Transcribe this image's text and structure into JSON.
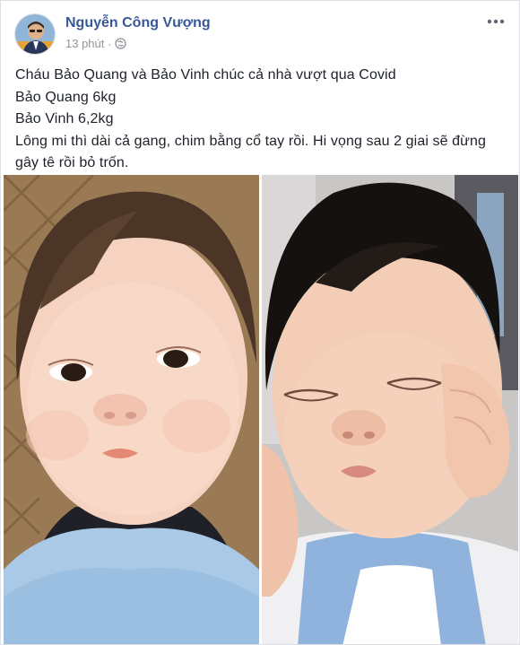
{
  "post": {
    "author": "Nguyễn Công Vượng",
    "time": "13 phút",
    "separator": "·",
    "privacy_icon": "globe-icon",
    "more_icon": "more-dots-icon",
    "text_lines": [
      "Cháu Bảo Quang và Bảo Vinh chúc cả nhà vượt qua Covid",
      "Bảo Quang 6kg",
      "Bảo Vinh 6,2kg",
      "Lông mi thì dài cả gang, chim bằng cổ tay rồi. Hi vọng sau 2 giai sẽ đừng",
      "gây tê rồi bỏ trốn."
    ],
    "photos": [
      {
        "name": "baby-photo-left",
        "subject": "baby with eyes open"
      },
      {
        "name": "baby-photo-right",
        "subject": "baby sleeping"
      }
    ]
  },
  "colors": {
    "author": "#385898",
    "text": "#1d2129",
    "meta": "#8f949b",
    "background": "#ffffff",
    "border": "#dddfe2"
  }
}
